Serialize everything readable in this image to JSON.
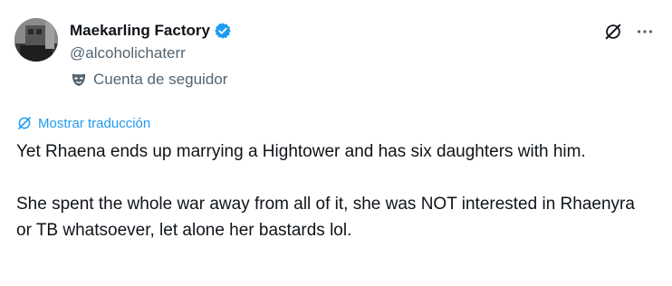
{
  "author": {
    "display_name": "Maekarling Factory",
    "handle": "@alcoholichaterr",
    "account_label": "Cuenta de seguidor",
    "verified": true
  },
  "icons": {
    "avatar": "avatar",
    "verified": "verified-badge-icon",
    "account_label": "mask-icon",
    "grok": "grok-icon",
    "more": "more-icon",
    "translate": "grok-icon"
  },
  "tweet": {
    "translate_label": "Mostrar traducción",
    "paragraphs": [
      "Yet Rhaena ends up marrying a Hightower and has six daughters with him.",
      "She spent the whole war away from all of it, she was NOT interested in Rhaenyra or TB whatsoever, let alone her bastards lol."
    ]
  },
  "colors": {
    "accent": "#1d9bf0",
    "text_primary": "#0f1419",
    "text_secondary": "#536471"
  }
}
